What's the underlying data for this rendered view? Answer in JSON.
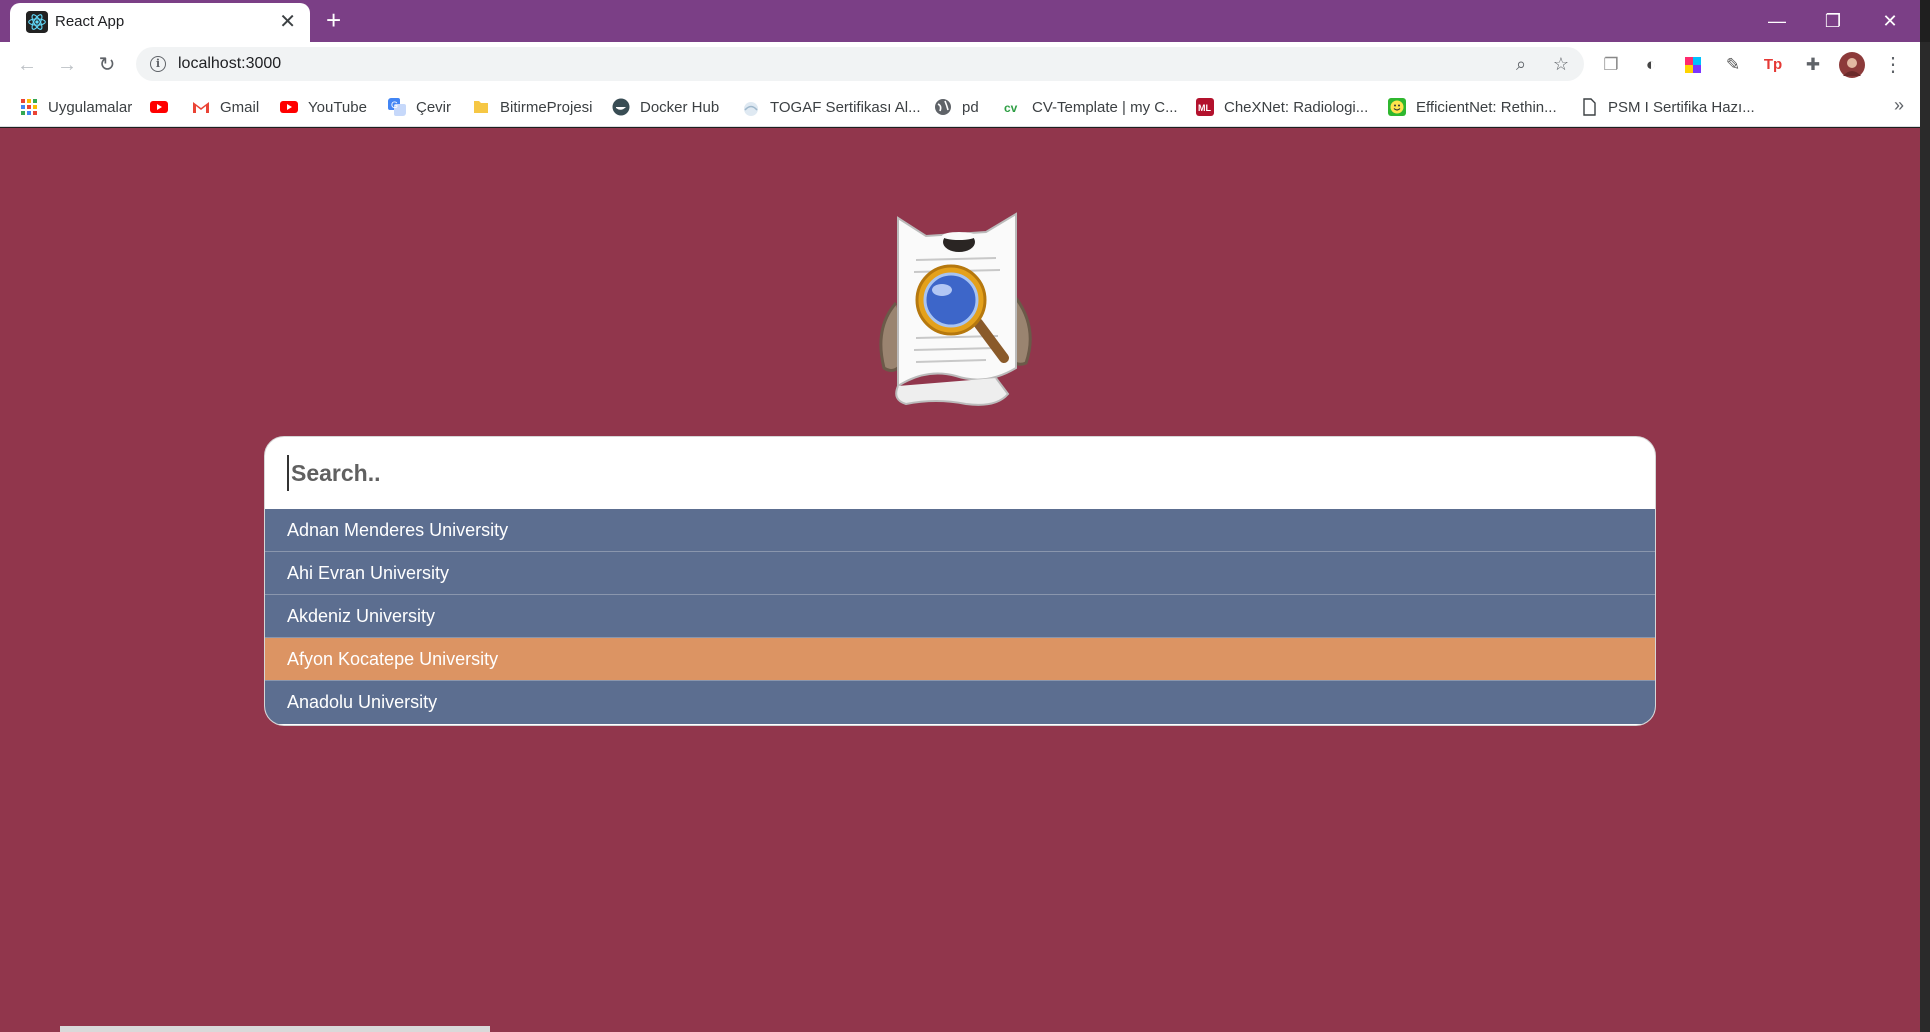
{
  "browser": {
    "tab_title": "React App",
    "tab_close": "✕",
    "new_tab": "+",
    "url": "localhost:3000",
    "window_controls": {
      "minimize": "—",
      "restore": "❐",
      "close": "✕"
    },
    "nav_icons": [
      "back-icon",
      "forward-icon",
      "reload-icon"
    ],
    "colors": {
      "frame": "#7b3f86",
      "toolbar": "#ffffff"
    }
  },
  "bookmarks": {
    "items": [
      {
        "label": "Uygulamalar",
        "icon": "apps-grid-icon",
        "color": "#ea4335"
      },
      {
        "label": "",
        "icon": "youtube-icon",
        "color": "#ff0000"
      },
      {
        "label": "Gmail",
        "icon": "gmail-icon",
        "color": "#ea4335"
      },
      {
        "label": "YouTube",
        "icon": "youtube-icon",
        "color": "#ff0000"
      },
      {
        "label": "Çevir",
        "icon": "translate-icon",
        "color": "#4285f4"
      },
      {
        "label": "BitirmeProjesi",
        "icon": "folder-icon",
        "color": "#f6c744"
      },
      {
        "label": "Docker Hub",
        "icon": "docker-icon",
        "color": "#394d54"
      },
      {
        "label": "TOGAF Sertifikası Al...",
        "icon": "togaf-icon",
        "color": "#9fb8cc"
      },
      {
        "label": "pd",
        "icon": "globe-icon",
        "color": "#5f6368"
      },
      {
        "label": "CV-Template | my C...",
        "icon": "cv-icon",
        "color": "#2e9e44"
      },
      {
        "label": "CheXNet: Radiologi...",
        "icon": "ml-icon",
        "color": "#b3122d"
      },
      {
        "label": "EfficientNet: Rethin...",
        "icon": "smiley-icon",
        "color": "#2fb72f"
      },
      {
        "label": "PSM I Sertifika Hazı...",
        "icon": "page-icon",
        "color": "#ffffff"
      }
    ],
    "more": "»"
  },
  "search": {
    "placeholder": "Search..",
    "value": ""
  },
  "results": {
    "items": [
      {
        "label": "Adnan Menderes University",
        "active": false
      },
      {
        "label": "Ahi Evran University",
        "active": false
      },
      {
        "label": "Akdeniz University",
        "active": false
      },
      {
        "label": "Afyon Kocatepe University",
        "active": true
      },
      {
        "label": "Anadolu University",
        "active": false
      }
    ],
    "colors": {
      "default": "#5c6e90",
      "active": "#dc9463",
      "background": "#91364c"
    }
  }
}
